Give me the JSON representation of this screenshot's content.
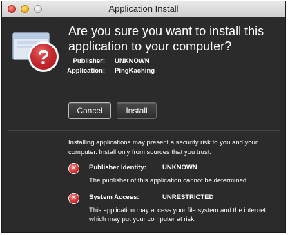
{
  "window": {
    "title": "Application Install"
  },
  "icons": {
    "close": "close-button-icon",
    "minimize": "minimize-button-icon",
    "zoom": "zoom-button-icon",
    "app": "application-window-question-icon",
    "risk": "red-x-warning-icon"
  },
  "colors": {
    "dialog_bg": "#2b2b2b",
    "titlebar_top": "#e9e9e9",
    "titlebar_bottom": "#cfcfcf",
    "question_red": "#c8232b",
    "text": "#ffffff"
  },
  "header": {
    "line1": "Are you sure you want to install this",
    "line2": "application to your computer?"
  },
  "details": {
    "publisher_label": "Publisher:",
    "publisher_value": "UNKNOWN",
    "application_label": "Application:",
    "application_value": "PingKaching"
  },
  "buttons": {
    "cancel": "Cancel",
    "install": "Install"
  },
  "warning": {
    "line1": "Installing applications may present a security risk to you and your",
    "line2": "computer. Install only from sources that you trust."
  },
  "risks": [
    {
      "label": "Publisher Identity:",
      "value": "UNKNOWN",
      "desc1": "The publisher of this application cannot be determined.",
      "desc2": ""
    },
    {
      "label": "System Access:",
      "value": "UNRESTRICTED",
      "desc1": "This application may access your file system and the internet,",
      "desc2": "which may put your computer at risk."
    }
  ]
}
